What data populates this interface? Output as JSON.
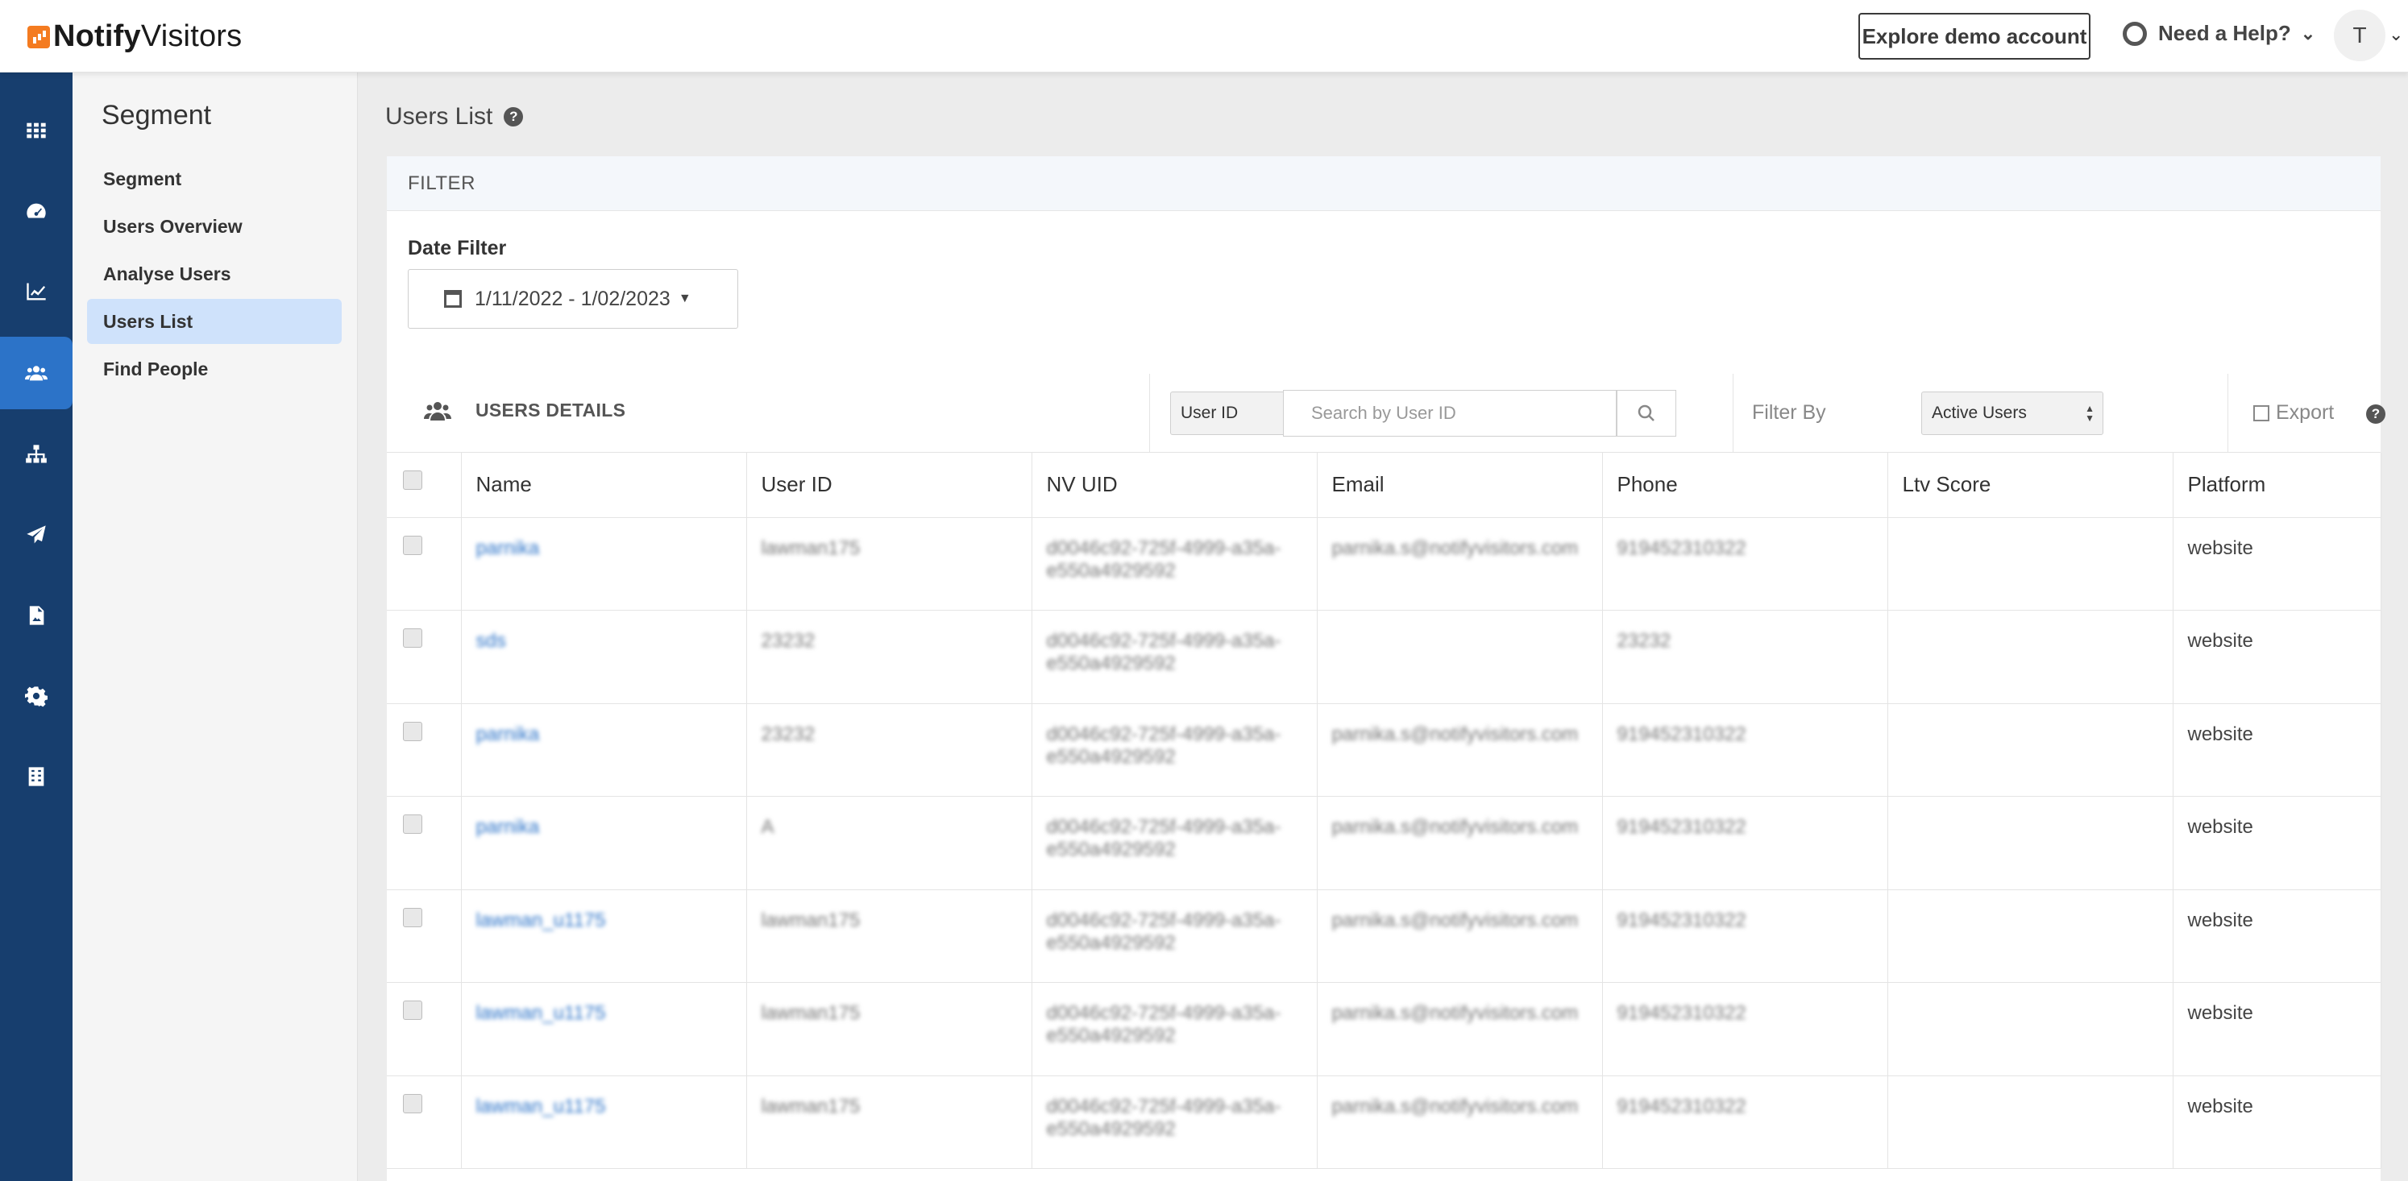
{
  "brand": {
    "name_bold": "Notify",
    "name_rest": "Visitors"
  },
  "topbar": {
    "demo_label": "Explore demo account",
    "help_label": "Need a Help?",
    "avatar_initial": "T"
  },
  "iconbar": {
    "items": [
      "apps-icon",
      "dashboard-icon",
      "analytics-icon",
      "users-icon",
      "hierarchy-icon",
      "send-icon",
      "image-report-icon",
      "settings-icon",
      "building-icon"
    ],
    "active_index": 3
  },
  "sidebar": {
    "title": "Segment",
    "items": [
      {
        "label": "Segment"
      },
      {
        "label": "Users Overview"
      },
      {
        "label": "Analyse Users"
      },
      {
        "label": "Users List"
      },
      {
        "label": "Find People"
      }
    ],
    "active_index": 3
  },
  "page": {
    "title": "Users List"
  },
  "filter": {
    "header": "FILTER",
    "date_label": "Date Filter",
    "date_value": "1/11/2022 - 1/02/2023"
  },
  "users_details": {
    "title": "USERS DETAILS",
    "search_field_select": "User ID",
    "search_placeholder": "Search by User ID",
    "filter_by_label": "Filter By",
    "filter_by_value": "Active Users",
    "export_label": "Export",
    "columns": [
      "Name",
      "User ID",
      "NV UID",
      "Email",
      "Phone",
      "Ltv Score",
      "Platform"
    ],
    "rows": [
      {
        "name": "parnika",
        "user_id": "lawman175",
        "nv_uid": "d0046c92-725f-4999-a35a-e550a4929592",
        "email": "parnika.s@notifyvisitors.com",
        "phone": "919452310322",
        "ltv": "",
        "platform": "website"
      },
      {
        "name": "sds",
        "user_id": "23232",
        "nv_uid": "d0046c92-725f-4999-a35a-e550a4929592",
        "email": "",
        "phone": "23232",
        "ltv": "",
        "platform": "website"
      },
      {
        "name": "parnika",
        "user_id": "23232",
        "nv_uid": "d0046c92-725f-4999-a35a-e550a4929592",
        "email": "parnika.s@notifyvisitors.com",
        "phone": "919452310322",
        "ltv": "",
        "platform": "website"
      },
      {
        "name": "parnika",
        "user_id": "A",
        "nv_uid": "d0046c92-725f-4999-a35a-e550a4929592",
        "email": "parnika.s@notifyvisitors.com",
        "phone": "919452310322",
        "ltv": "",
        "platform": "website"
      },
      {
        "name": "lawman_u1175",
        "user_id": "lawman175",
        "nv_uid": "d0046c92-725f-4999-a35a-e550a4929592",
        "email": "parnika.s@notifyvisitors.com",
        "phone": "919452310322",
        "ltv": "",
        "platform": "website"
      },
      {
        "name": "lawman_u1175",
        "user_id": "lawman175",
        "nv_uid": "d0046c92-725f-4999-a35a-e550a4929592",
        "email": "parnika.s@notifyvisitors.com",
        "phone": "919452310322",
        "ltv": "",
        "platform": "website"
      },
      {
        "name": "lawman_u1175",
        "user_id": "lawman175",
        "nv_uid": "d0046c92-725f-4999-a35a-e550a4929592",
        "email": "parnika.s@notifyvisitors.com",
        "phone": "919452310322",
        "ltv": "",
        "platform": "website"
      }
    ]
  },
  "colors": {
    "sidebar_dark": "#173e6e",
    "accent": "#2c73c8",
    "active_subnav": "#cfe2fb",
    "logo_orange": "#f47b20"
  }
}
